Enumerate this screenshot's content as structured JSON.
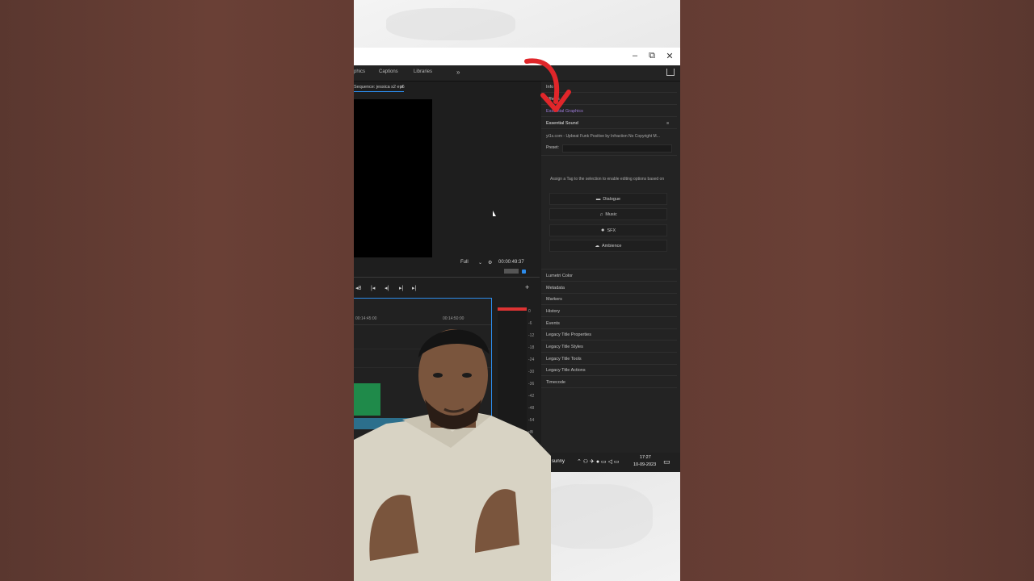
{
  "window": {
    "minimize": "–",
    "restore": "⧉",
    "close": "✕"
  },
  "tabs": [
    {
      "label": "phics"
    },
    {
      "label": "Captions"
    },
    {
      "label": "Libraries"
    },
    {
      "label": "»"
    }
  ],
  "sequence": {
    "title": "Sequence: jessica s2 ep6",
    "menu": "≡"
  },
  "monitor": {
    "resolution": "Full",
    "timecode": "00:00:49:37"
  },
  "timeline": {
    "ruler_labels": [
      "00:14:45:00",
      "00:14:50:00"
    ],
    "add_label": "+"
  },
  "meter": {
    "scale": [
      "0",
      "-6",
      "-12",
      "-18",
      "-24",
      "-30",
      "-36",
      "-42",
      "-48",
      "-54",
      "dB"
    ]
  },
  "right_panel": {
    "top_items": [
      "Info",
      "Effects",
      "Essential Graphics"
    ],
    "essential_sound": {
      "title": "Essential Sound",
      "clip_name": "yt1s.com - Upbeat Funk Positive by Infraction No Copyright M...",
      "preset_label": "Preset:",
      "hint": "Assign a Tag to the selection to enable editing options based on",
      "buttons": [
        {
          "label": "Dialogue",
          "icon": "speech-bubble-icon"
        },
        {
          "label": "Music",
          "icon": "music-note-icon"
        },
        {
          "label": "SFX",
          "icon": "sparkle-icon"
        },
        {
          "label": "Ambience",
          "icon": "ambience-icon"
        }
      ]
    },
    "other_panels": [
      "Lumetri Color",
      "Metadata",
      "Markers",
      "History",
      "Events",
      "Legacy Title Properties",
      "Legacy Title Styles",
      "Legacy Title Tools",
      "Legacy Title Actions",
      "Timecode"
    ]
  },
  "taskbar": {
    "weather": "artly sunny",
    "time": "17:27",
    "date": "10-09-2023"
  },
  "colors": {
    "arrow": "#e0262a",
    "accent_blue": "#2d8ceb",
    "clip_green": "#1f8a4a"
  }
}
